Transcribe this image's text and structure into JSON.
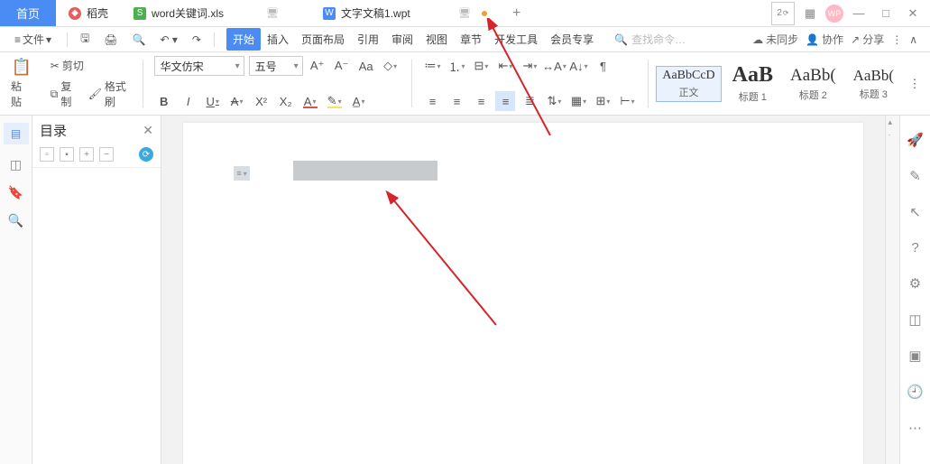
{
  "titlebar": {
    "home": "首页",
    "tabs": [
      {
        "icon": "red",
        "label": "稻壳"
      },
      {
        "icon": "green",
        "iconLetter": "S",
        "label": "word关键词.xls"
      },
      {
        "icon": "blue",
        "iconLetter": "W",
        "label": "文字文稿1.wpt",
        "active": true,
        "dirty": true
      }
    ],
    "newtab": "+",
    "sysNum": "2",
    "avatar": "WP"
  },
  "menubar": {
    "fileMenu": "文件",
    "ribbonTabs": [
      "开始",
      "插入",
      "页面布局",
      "引用",
      "审阅",
      "视图",
      "章节",
      "开发工具",
      "会员专享"
    ],
    "activeRibbon": 0,
    "searchPlaceholder": "查找命令…",
    "unsynced": "未同步",
    "collab": "协作",
    "share": "分享"
  },
  "ribbon": {
    "paste": "粘贴",
    "cut": "剪切",
    "copy": "复制",
    "formatPainter": "格式刷",
    "fontName": "华文仿宋",
    "fontSize": "五号",
    "styles": [
      {
        "preview": "AaBbCcD",
        "label": "正文",
        "previewSize": "14px",
        "selected": true
      },
      {
        "preview": "AaB",
        "label": "标题 1",
        "previewSize": "24px",
        "bold": true
      },
      {
        "preview": "AaBb(",
        "label": "标题 2",
        "previewSize": "19px"
      },
      {
        "preview": "AaBb(",
        "label": "标题 3",
        "previewSize": "17px"
      }
    ]
  },
  "nav": {
    "title": "目录"
  }
}
